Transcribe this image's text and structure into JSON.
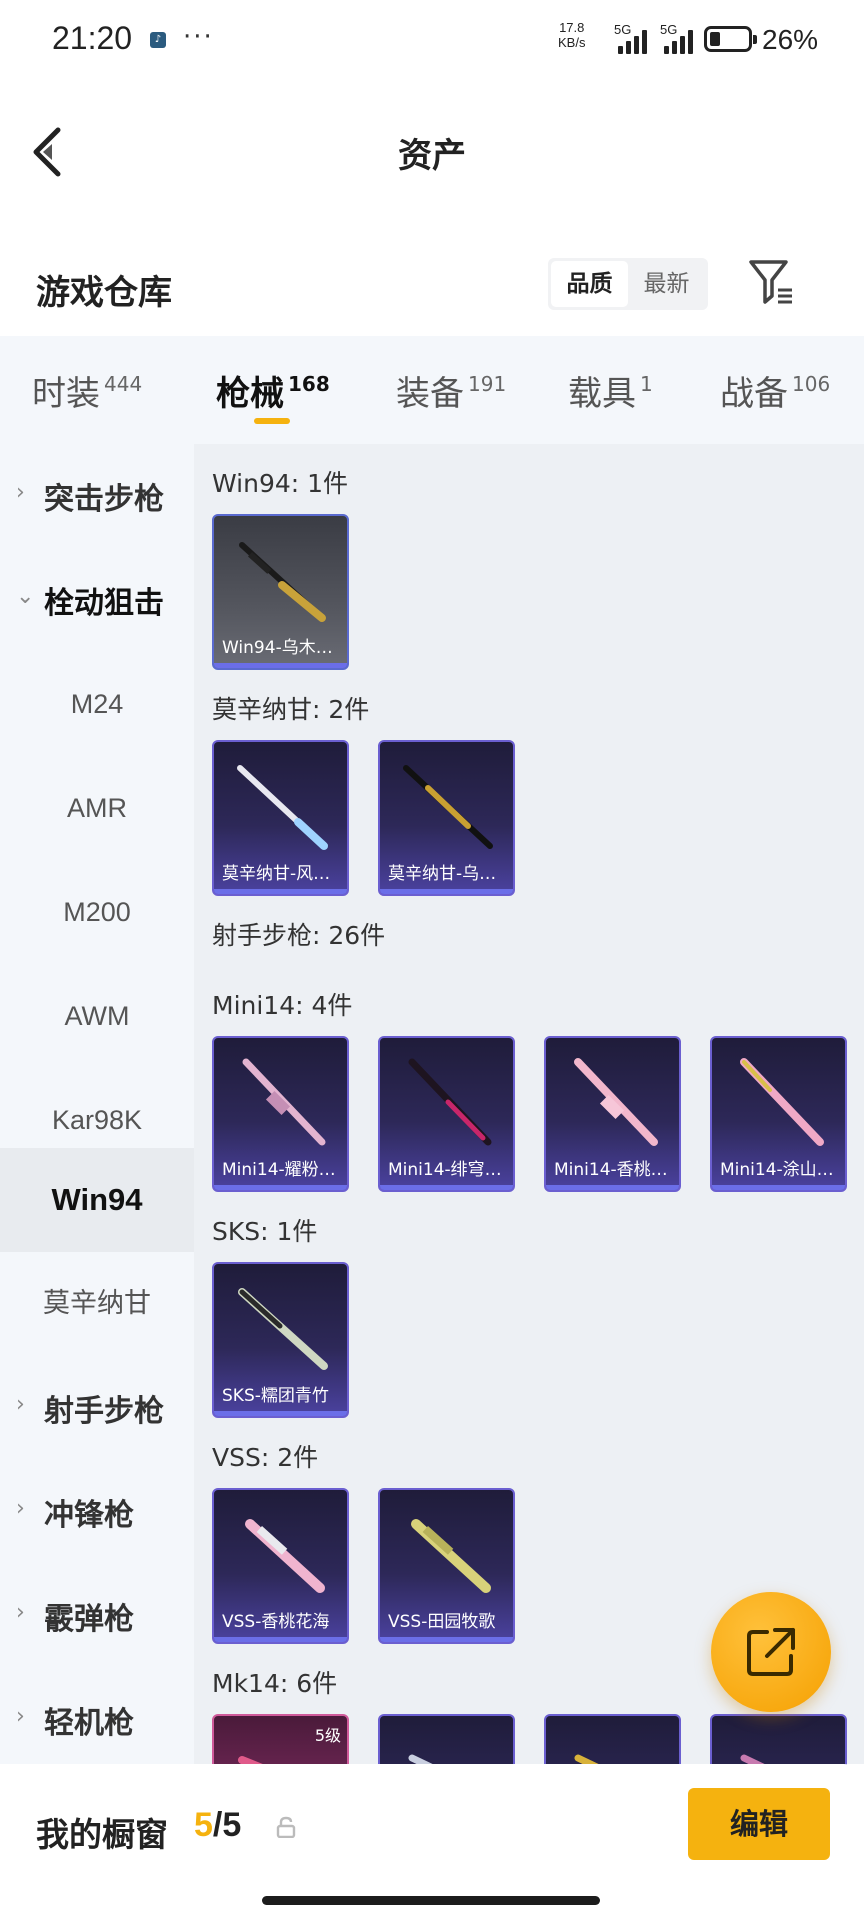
{
  "status_bar": {
    "time": "21:20",
    "speed_value": "17.8",
    "speed_unit": "KB/s",
    "signal1": "5G",
    "signal2": "5G",
    "battery_pct": "26%",
    "dots": "···"
  },
  "header": {
    "title": "资产",
    "back_icon": "chevron-left-icon"
  },
  "warehouse": {
    "title": "游戏仓库",
    "sort_options": [
      "品质",
      "最新"
    ],
    "sort_selected": "品质",
    "filter_icon": "filter-icon"
  },
  "tabs": [
    {
      "label": "时装",
      "count": "444"
    },
    {
      "label": "枪械",
      "count": "168",
      "active": true
    },
    {
      "label": "装备",
      "count": "191"
    },
    {
      "label": "载具",
      "count": "1"
    },
    {
      "label": "战备",
      "count": "106"
    }
  ],
  "sidebar": {
    "categories": [
      {
        "label": "突击步枪",
        "expanded": false
      },
      {
        "label": "栓动狙击",
        "expanded": true
      },
      {
        "label": "射手步枪",
        "expanded": false
      },
      {
        "label": "冲锋枪",
        "expanded": false
      },
      {
        "label": "霰弹枪",
        "expanded": false
      },
      {
        "label": "轻机枪",
        "expanded": false
      }
    ],
    "subitems": [
      "M24",
      "AMR",
      "M200",
      "AWM",
      "Kar98K",
      "Win94",
      "莫辛纳甘"
    ],
    "active_subitem": "Win94"
  },
  "content": {
    "groups": [
      {
        "title": "Win94: 1件",
        "items": [
          "Win94-乌木…"
        ]
      },
      {
        "title": "莫辛纳甘: 2件",
        "items": [
          "莫辛纳甘-风…",
          "莫辛纳甘-乌…"
        ]
      },
      {
        "title": "射手步枪: 26件"
      },
      {
        "title": "Mini14: 4件",
        "items": [
          "Mini14-耀粉…",
          "Mini14-绯穹…",
          "Mini14-香桃…",
          "Mini14-涂山…"
        ]
      },
      {
        "title": "SKS: 1件",
        "items": [
          "SKS-糯团青竹"
        ]
      },
      {
        "title": "VSS: 2件",
        "items": [
          "VSS-香桃花海",
          "VSS-田园牧歌"
        ]
      },
      {
        "title": "Mk14: 6件",
        "first_item_level": "5级"
      }
    ]
  },
  "fab": {
    "icon": "share-external-icon"
  },
  "bottom_bar": {
    "label": "我的橱窗",
    "current": "5",
    "separator": "/",
    "max": "5",
    "lock_icon": "lock-icon",
    "edit_label": "编辑"
  },
  "colors": {
    "accent": "#f5b20f",
    "card_border": "#6b5fd0",
    "sidebar_bg": "#f4f7fb",
    "content_bg": "#edf0f4"
  }
}
